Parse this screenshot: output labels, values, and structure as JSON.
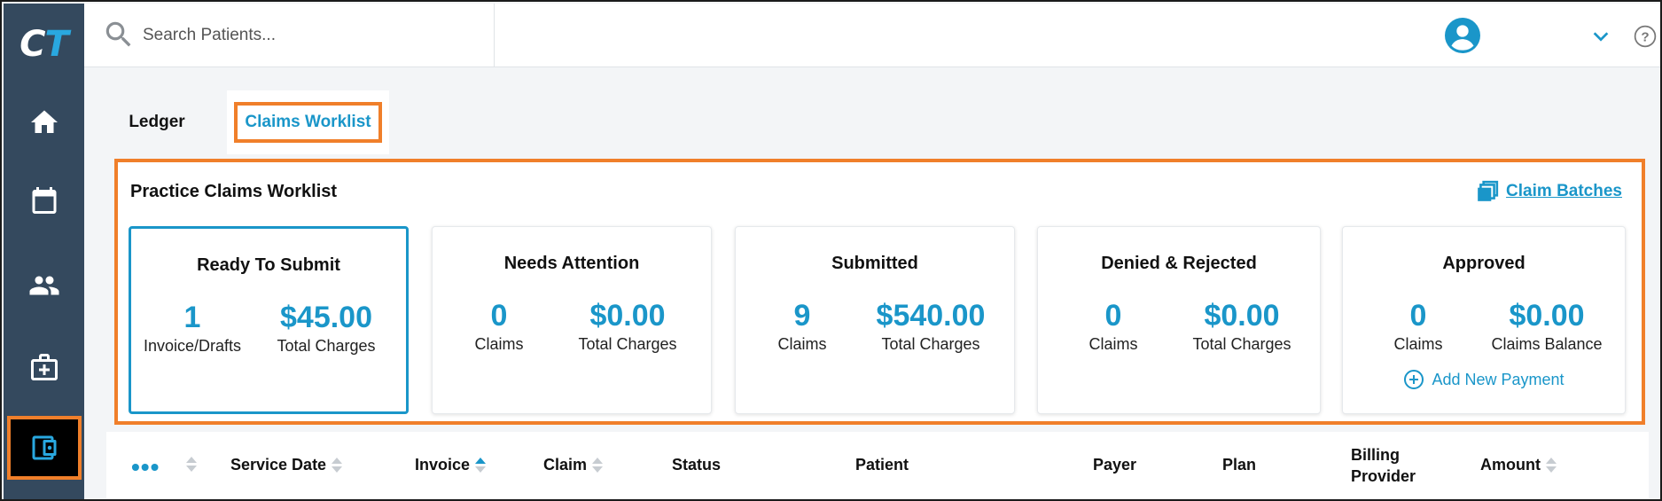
{
  "app": {
    "logo_text": "CT"
  },
  "sidebar": {
    "items": [
      {
        "name": "home",
        "icon": "home-icon"
      },
      {
        "name": "calendar",
        "icon": "calendar-icon"
      },
      {
        "name": "patients",
        "icon": "people-icon"
      },
      {
        "name": "clinical",
        "icon": "medical-bag-icon"
      },
      {
        "name": "billing",
        "icon": "wallet-icon",
        "active": true
      }
    ]
  },
  "header": {
    "search_placeholder": "Search Patients...",
    "user_icon": "user-avatar-icon",
    "dropdown_icon": "chevron-down-icon",
    "help_icon": "help-icon"
  },
  "tabs": [
    {
      "label": "Ledger",
      "active": false
    },
    {
      "label": "Claims Worklist",
      "active": true
    }
  ],
  "worklist": {
    "title": "Practice Claims Worklist",
    "batches_label": "Claim Batches",
    "cards": [
      {
        "title": "Ready To Submit",
        "count": "1",
        "count_label": "Invoice/Drafts",
        "amount": "$45.00",
        "amount_label": "Total Charges",
        "selected": true
      },
      {
        "title": "Needs Attention",
        "count": "0",
        "count_label": "Claims",
        "amount": "$0.00",
        "amount_label": "Total Charges"
      },
      {
        "title": "Submitted",
        "count": "9",
        "count_label": "Claims",
        "amount": "$540.00",
        "amount_label": "Total Charges"
      },
      {
        "title": "Denied & Rejected",
        "count": "0",
        "count_label": "Claims",
        "amount": "$0.00",
        "amount_label": "Total Charges"
      },
      {
        "title": "Approved",
        "count": "0",
        "count_label": "Claims",
        "amount": "$0.00",
        "amount_label": "Claims Balance",
        "action": "Add New Payment"
      }
    ]
  },
  "table": {
    "menu_label": "•••",
    "columns": [
      {
        "label": "Service Date",
        "sortable": true
      },
      {
        "label": "Invoice",
        "sortable": true,
        "sort": "asc"
      },
      {
        "label": "Claim",
        "sortable": true
      },
      {
        "label": "Status",
        "sortable": false
      },
      {
        "label": "Patient",
        "sortable": false
      },
      {
        "label": "Payer",
        "sortable": false
      },
      {
        "label": "Plan",
        "sortable": false
      },
      {
        "label": "Billing Provider",
        "sortable": false
      },
      {
        "label": "Amount",
        "sortable": true
      }
    ]
  },
  "colors": {
    "sidebar": "#34495e",
    "accent": "#1a96c9",
    "highlight": "#f07f2a"
  }
}
